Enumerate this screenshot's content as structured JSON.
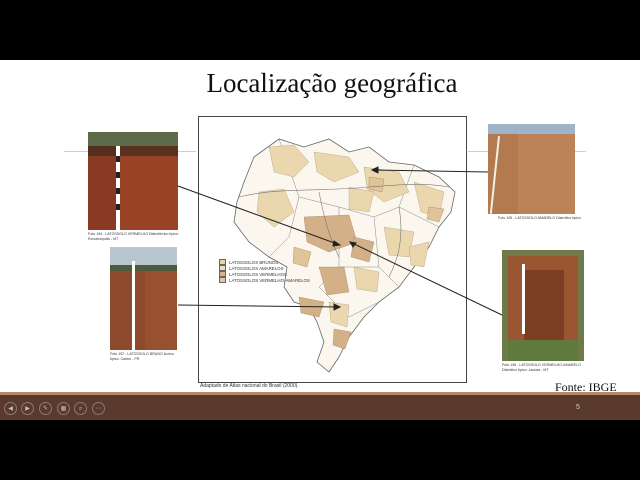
{
  "slide": {
    "title": "Localização geográfica",
    "source": "Fonte: IBGE",
    "map_caption": "Adaptado de Atlas nacional do Brasil (2000).",
    "page_number": "5"
  },
  "legend": {
    "items": [
      {
        "label": "LATOSSOLOS BRUNOS",
        "color": "#e8d3a6"
      },
      {
        "label": "LATOSSOLOS AMARELOS",
        "color": "#efdcb5"
      },
      {
        "label": "LATOSSOLOS VERMELHOS",
        "color": "#d6b389"
      },
      {
        "label": "LATOSSOLOS VERMELHO-AMARELOS",
        "color": "#e4c79e"
      }
    ]
  },
  "photos": {
    "top_left": {
      "caption": "Foto 194 - LATOSSOLO VERMELHO Distroférrico típico. Rondonópolis - MT"
    },
    "mid_left": {
      "caption": "Foto 197 - LATOSSOLO BRUNO Ácrico típico. Castro - PR"
    },
    "top_right": {
      "caption": "Foto 195 - LATOSSOLO AMARELO Distrófico típico"
    },
    "mid_right": {
      "caption": "Foto 196 - LATOSSOLO VERMELHO-AMARELO Distrófico típico. Jaciara - MT"
    }
  },
  "controls": {
    "prev": "◀",
    "next": "▶",
    "pen": "✎",
    "slides": "▦",
    "zoom": "⌕",
    "more": "⋯"
  }
}
